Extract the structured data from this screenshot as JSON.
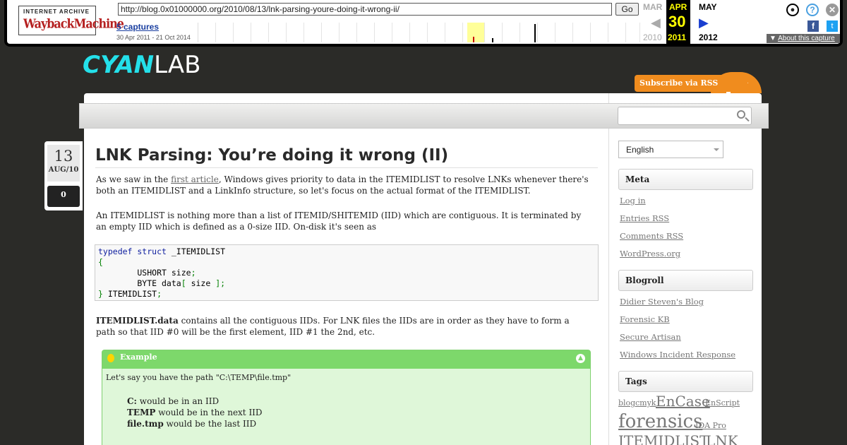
{
  "wayback": {
    "logo_top": "INTERNET ARCHIVE",
    "logo_bottom": "WaybackMachine",
    "url": "http://blog.0x01000000.org/2010/08/13/lnk-parsing-youre-doing-it-wrong-ii/",
    "go_label": "Go",
    "captures": "5 captures",
    "range": "30 Apr 2011 - 21 Oct 2014",
    "prev_month": "MAR",
    "cur_month": "APR",
    "next_month": "MAY",
    "cur_day": "30",
    "prev_year": "2010",
    "cur_year": "2011",
    "next_year": "2012",
    "about": "About this capture"
  },
  "blog": {
    "logo_a": "CYAN",
    "logo_b": "LAB",
    "rss_label": "Subscribe via RSS",
    "search_placeholder": ""
  },
  "post": {
    "day": "13",
    "month": "AUG/10",
    "comments": "0",
    "title": "LNK Parsing: You’re doing it wrong (II)",
    "p1_a": "As we saw in the ",
    "p1_link": "first article",
    "p1_b": ", Windows gives priority to data in the ITEMIDLIST to resolve LNKs whenever there's both an ITEMIDLIST and a LinkInfo structure, so let's focus on the actual format of the ITEMIDLIST.",
    "p2": "An ITEMIDLIST is nothing more than a list of ITEMID/SHITEMID (IID) which are contiguous. It is terminated by an empty IID which is defined as a 0-size IID. On-disk it's seen as",
    "code": {
      "l1_kw": "typedef struct",
      "l1_rest": " _ITEMIDLIST",
      "l2": "{",
      "l3_a": "        USHORT size",
      "l3_b": ";",
      "l4_a": "        BYTE data",
      "l4_b": "[",
      "l4_c": " size ",
      "l4_d": "];",
      "l5_a": "}",
      "l5_b": " ITEMIDLIST",
      "l5_c": ";"
    },
    "p3_bold": "ITEMIDLIST.data",
    "p3": " contains all the contiguous IIDs. For LNK files the IIDs are in order as they have to form a path so that IID #0 will be the first element, IID #1 the 2nd, etc.",
    "example": {
      "header": "Example",
      "intro": "Let's say you have the path \"C:\\TEMP\\file.tmp\"",
      "items": [
        {
          "bold": "C:",
          "rest": " would be in an IID"
        },
        {
          "bold": "TEMP",
          "rest": " would be in the next IID"
        },
        {
          "bold": "file.tmp",
          "rest": " would be the last IID"
        }
      ]
    }
  },
  "sidebar": {
    "language": "English",
    "meta_title": "Meta",
    "meta": [
      "Log in",
      "Entries RSS",
      "Comments RSS",
      "WordPress.org"
    ],
    "blogroll_title": "Blogroll",
    "blogroll": [
      "Didier Steven's Blog",
      "Forensic KB",
      "Secure Artisan",
      "Windows Incident Response"
    ],
    "tags_title": "Tags",
    "tags": [
      "blog",
      "cmyk",
      "EnCase",
      "EnScript",
      "forensics",
      "IDA Pro",
      "ITEMIDLIST",
      "LNK"
    ]
  }
}
